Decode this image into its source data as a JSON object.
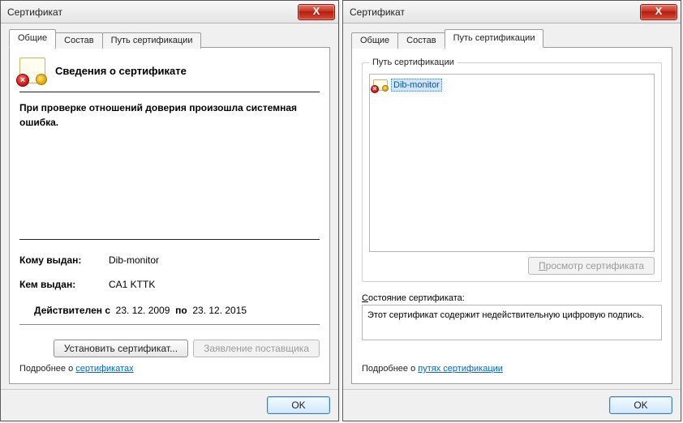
{
  "left": {
    "title": "Сертификат",
    "tabs": {
      "general": "Общие",
      "details": "Состав",
      "path": "Путь сертификации"
    },
    "info_header": "Сведения о сертификате",
    "error_msg": "При проверке отношений доверия произошла системная ошибка.",
    "issued_to_label": "Кому выдан:",
    "issued_to_value": "Dib-monitor",
    "issued_by_label": "Кем выдан:",
    "issued_by_value": "CA1 KTTK",
    "valid_from_label": "Действителен с",
    "valid_from": "23. 12. 2009",
    "valid_to_label": "по",
    "valid_to": "23. 12. 2015",
    "install_btn": "Установить сертификат...",
    "issuer_stmt_btn": "Заявление поставщика",
    "learn_prefix": "Подробнее о ",
    "learn_link": "сертификатах",
    "ok": "OK"
  },
  "right": {
    "title": "Сертификат",
    "tabs": {
      "general": "Общие",
      "details": "Состав",
      "path": "Путь сертификации"
    },
    "group_label": "Путь сертификации",
    "tree_item": "Dib-monitor",
    "view_btn": "Просмотр сертификата",
    "status_label": "Состояние сертификата:",
    "status_value": "Этот сертификат содержит недействительную цифровую подпись.",
    "learn_prefix": "Подробнее о ",
    "learn_link": "путях сертификации",
    "ok": "OK"
  }
}
